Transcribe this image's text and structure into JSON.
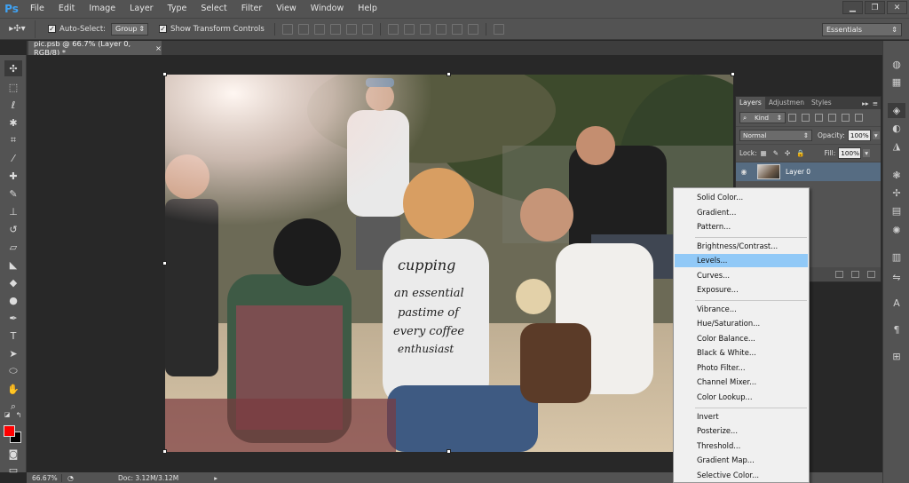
{
  "app": {
    "logo": "Ps"
  },
  "menu": [
    "File",
    "Edit",
    "Image",
    "Layer",
    "Type",
    "Select",
    "Filter",
    "View",
    "Window",
    "Help"
  ],
  "window_controls": {
    "minimize": "▁",
    "restore": "❐",
    "close": "✕"
  },
  "options": {
    "tool_preset": "▸✣▾",
    "auto_select_label": "Auto-Select:",
    "auto_select_checked": "✓",
    "auto_select_target": "Group",
    "show_transform_label": "Show Transform Controls",
    "show_transform_checked": "✓",
    "workspace": "Essentials"
  },
  "document_tab": {
    "title": "pic.psb @ 66.7% (Layer 0, RGB/8) *",
    "close": "×"
  },
  "status": {
    "zoom": "66.67%",
    "doc_size": "Doc: 3.12M/3.12M"
  },
  "layers_panel": {
    "tabs": [
      "Layers",
      "Adjustmen",
      "Styles"
    ],
    "kind_label": "Kind",
    "blend_mode": "Normal",
    "opacity_label": "Opacity:",
    "opacity_value": "100%",
    "lock_label": "Lock:",
    "fill_label": "Fill:",
    "fill_value": "100%",
    "layer_name": "Layer 0"
  },
  "adjustment_menu": {
    "group1": [
      "Solid Color...",
      "Gradient...",
      "Pattern..."
    ],
    "group2": [
      "Brightness/Contrast...",
      "Levels...",
      "Curves...",
      "Exposure..."
    ],
    "group3": [
      "Vibrance...",
      "Hue/Saturation...",
      "Color Balance...",
      "Black & White...",
      "Photo Filter...",
      "Channel Mixer...",
      "Color Lookup..."
    ],
    "group4": [
      "Invert",
      "Posterize...",
      "Threshold...",
      "Gradient Map...",
      "Selective Color..."
    ],
    "highlighted": "Levels..."
  },
  "colors": {
    "foreground": "#ff0000",
    "background": "#000000",
    "menu_highlight": "#91c9f7",
    "selected_layer": "#566c82"
  },
  "photo": {
    "shirt_text": [
      "cupping",
      "an essential",
      "pastime of",
      "every coffee",
      "enthusiast"
    ]
  }
}
